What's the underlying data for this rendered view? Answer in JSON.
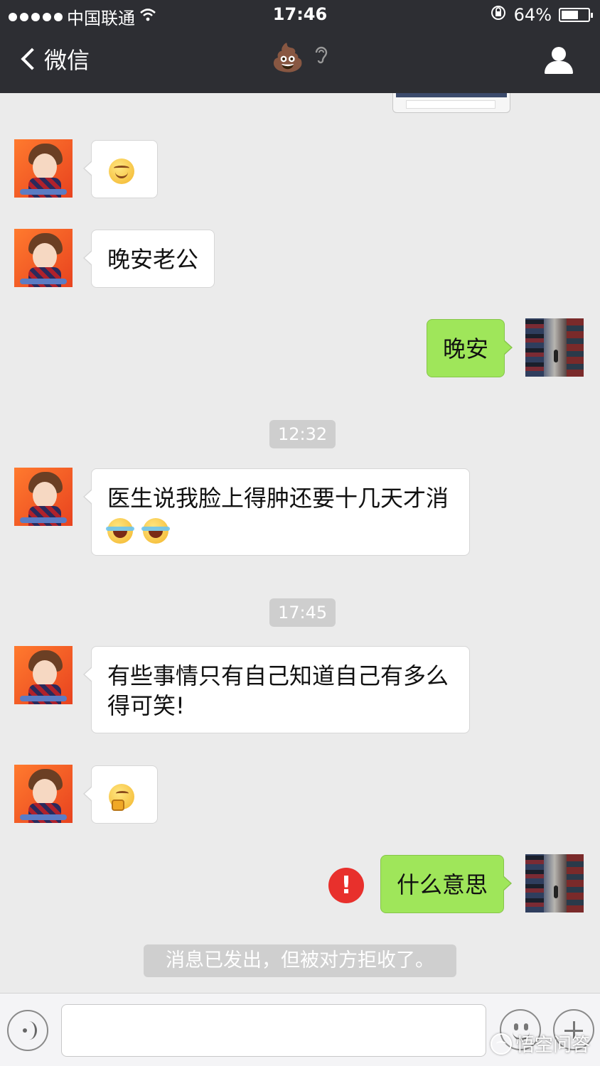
{
  "status_bar": {
    "carrier": "中国联通",
    "time": "17:46",
    "battery": "64%",
    "battery_level": 0.64
  },
  "nav": {
    "back_label": "微信",
    "title_emoji": "💩",
    "ear_icon": "ear-icon",
    "profile_icon": "person-icon"
  },
  "messages": [
    {
      "side": "left",
      "type": "emoji",
      "emoji": "smile"
    },
    {
      "side": "left",
      "type": "text",
      "text": "晚安老公"
    },
    {
      "side": "right",
      "type": "text",
      "text": "晚安"
    },
    {
      "type": "timestamp",
      "text": "12:32"
    },
    {
      "side": "left",
      "type": "text",
      "text": "医生说我脸上得肿还要十几天才消"
    },
    {
      "type": "timestamp",
      "text": "17:45"
    },
    {
      "side": "left",
      "type": "text",
      "text": "有些事情只有自己知道自己有多么得可笑!"
    },
    {
      "side": "left",
      "type": "emoji",
      "emoji": "thinking"
    },
    {
      "side": "right",
      "type": "text",
      "text": "什么意思",
      "failed": true
    }
  ],
  "system_notice": "消息已发出，但被对方拒收了。",
  "input": {
    "placeholder": "",
    "value": ""
  },
  "watermark": "悟空问答",
  "colors": {
    "topbar": "#2d2e33",
    "background": "#ebebeb",
    "sent_bubble": "#9fe65a",
    "received_bubble": "#ffffff",
    "error": "#e8302c"
  }
}
